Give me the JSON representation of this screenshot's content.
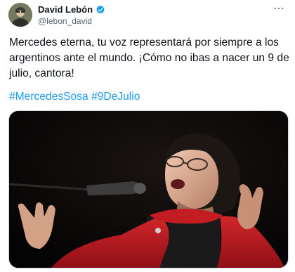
{
  "author": {
    "display_name": "David Lebón",
    "handle": "@lebon_david",
    "verified": true,
    "avatar_icon": "user-avatar"
  },
  "tweet": {
    "text": "Mercedes eterna, tu voz representará por siempre a los argentinos ante el mundo. ¡Cómo no ibas a nacer un 9 de julio, cantora!",
    "hashtags": [
      "#MercedesSosa",
      "#9DeJulio"
    ]
  },
  "menu": {
    "more_label": "⋯"
  },
  "media": {
    "icon": "photo",
    "dominant_colors": [
      "#c8191e",
      "#0b0a0b"
    ]
  },
  "colors": {
    "accent": "#1d9bf0",
    "text": "#0f1419",
    "muted": "#536471"
  }
}
